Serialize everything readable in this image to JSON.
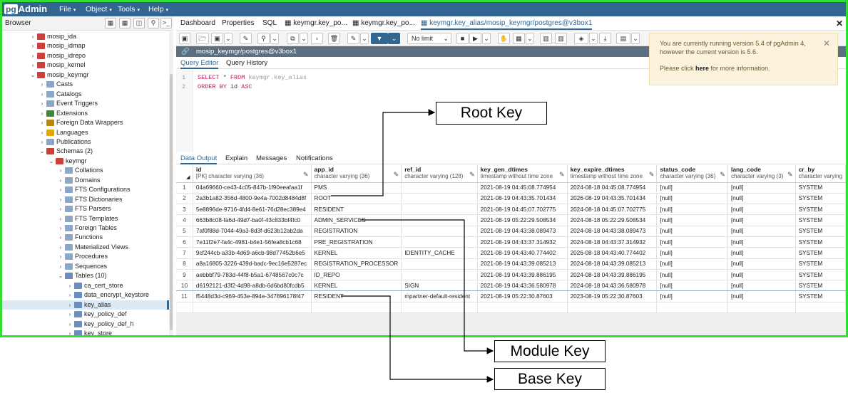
{
  "app": {
    "logo_pg": "pg",
    "logo_rest": "Admin"
  },
  "menu": [
    "File",
    "Object",
    "Tools",
    "Help"
  ],
  "browser": {
    "title": "Browser"
  },
  "tree": [
    {
      "label": "mosip_ida",
      "depth": 0,
      "expanded": false,
      "icon": "database-icon"
    },
    {
      "label": "mosip_idmap",
      "depth": 0,
      "expanded": false,
      "icon": "database-icon"
    },
    {
      "label": "mosip_idrepo",
      "depth": 0,
      "expanded": false,
      "icon": "database-icon"
    },
    {
      "label": "mosip_kernel",
      "depth": 0,
      "expanded": false,
      "icon": "database-icon"
    },
    {
      "label": "mosip_keymgr",
      "depth": 0,
      "expanded": true,
      "icon": "database-icon"
    },
    {
      "label": "Casts",
      "depth": 1,
      "expanded": false,
      "icon": "casts-icon"
    },
    {
      "label": "Catalogs",
      "depth": 1,
      "expanded": false,
      "icon": "catalogs-icon"
    },
    {
      "label": "Event Triggers",
      "depth": 1,
      "expanded": false,
      "icon": "event-trigger-icon"
    },
    {
      "label": "Extensions",
      "depth": 1,
      "expanded": false,
      "icon": "extension-icon"
    },
    {
      "label": "Foreign Data Wrappers",
      "depth": 1,
      "expanded": false,
      "icon": "fdw-icon"
    },
    {
      "label": "Languages",
      "depth": 1,
      "expanded": false,
      "icon": "language-icon"
    },
    {
      "label": "Publications",
      "depth": 1,
      "expanded": false,
      "icon": "publication-icon"
    },
    {
      "label": "Schemas (2)",
      "depth": 1,
      "expanded": true,
      "icon": "schemas-icon"
    },
    {
      "label": "keymgr",
      "depth": 2,
      "expanded": true,
      "icon": "schema-icon"
    },
    {
      "label": "Collations",
      "depth": 3,
      "expanded": false,
      "icon": "collation-icon"
    },
    {
      "label": "Domains",
      "depth": 3,
      "expanded": false,
      "icon": "domain-icon"
    },
    {
      "label": "FTS Configurations",
      "depth": 3,
      "expanded": false,
      "icon": "fts-config-icon"
    },
    {
      "label": "FTS Dictionaries",
      "depth": 3,
      "expanded": false,
      "icon": "fts-dictionary-icon"
    },
    {
      "label": "FTS Parsers",
      "depth": 3,
      "expanded": false,
      "icon": "fts-parser-icon"
    },
    {
      "label": "FTS Templates",
      "depth": 3,
      "expanded": false,
      "icon": "fts-template-icon"
    },
    {
      "label": "Foreign Tables",
      "depth": 3,
      "expanded": false,
      "icon": "foreign-table-icon"
    },
    {
      "label": "Functions",
      "depth": 3,
      "expanded": false,
      "icon": "function-icon"
    },
    {
      "label": "Materialized Views",
      "depth": 3,
      "expanded": false,
      "icon": "mview-icon"
    },
    {
      "label": "Procedures",
      "depth": 3,
      "expanded": false,
      "icon": "procedure-icon"
    },
    {
      "label": "Sequences",
      "depth": 3,
      "expanded": false,
      "icon": "sequence-icon"
    },
    {
      "label": "Tables (10)",
      "depth": 3,
      "expanded": true,
      "icon": "tables-icon"
    },
    {
      "label": "ca_cert_store",
      "depth": 4,
      "expanded": false,
      "icon": "table-icon"
    },
    {
      "label": "data_encrypt_keystore",
      "depth": 4,
      "expanded": false,
      "icon": "table-icon"
    },
    {
      "label": "key_alias",
      "depth": 4,
      "expanded": false,
      "icon": "table-icon",
      "selected": true
    },
    {
      "label": "key_policy_def",
      "depth": 4,
      "expanded": false,
      "icon": "table-icon"
    },
    {
      "label": "key_policy_def_h",
      "depth": 4,
      "expanded": false,
      "icon": "table-icon"
    },
    {
      "label": "key_store",
      "depth": 4,
      "expanded": false,
      "icon": "table-icon"
    }
  ],
  "tabs": [
    "Dashboard",
    "Properties",
    "SQL",
    "keymgr.key_po...",
    "keymgr.key_po...",
    "keymgr.key_alias/mosip_keymgr/postgres@v3box1"
  ],
  "toolbar": {
    "limit": "No limit"
  },
  "connection": "mosip_keymgr/postgres@v3box1",
  "query_tabs": [
    "Query Editor",
    "Query History"
  ],
  "editor": {
    "line1_num": "1",
    "line2_num": "2",
    "l1_kw1": "SELECT",
    "l1_star": " * ",
    "l1_kw2": "FROM",
    "l1_schema": " keymgr.",
    "l1_tbl": "key_alias",
    "l2_kw1": "ORDER BY",
    "l2_col": " id ",
    "l2_kw2": "ASC"
  },
  "notice": {
    "line1": "You are currently running version 5.4 of pgAdmin 4,",
    "line2": "however the current version is 5.6.",
    "line3a": "Please click ",
    "line3b": "here",
    "line3c": " for more information."
  },
  "output_tabs": [
    "Data Output",
    "Explain",
    "Messages",
    "Notifications"
  ],
  "grid": {
    "columns": [
      {
        "name": "id",
        "type": "[PK] character varying (36)"
      },
      {
        "name": "app_id",
        "type": "character varying (36)"
      },
      {
        "name": "ref_id",
        "type": "character varying (128)"
      },
      {
        "name": "key_gen_dtimes",
        "type": "timestamp without time zone"
      },
      {
        "name": "key_expire_dtimes",
        "type": "timestamp without time zone"
      },
      {
        "name": "status_code",
        "type": "character varying (36)"
      },
      {
        "name": "lang_code",
        "type": "character varying (3)"
      },
      {
        "name": "cr_by",
        "type": "character varying"
      }
    ],
    "rows": [
      [
        "1",
        "04a69660-ce43-4c05-847b-1f90eeafaa1f",
        "PMS",
        "",
        "2021-08-19 04:45:08.774954",
        "2024-08-18 04:45:08.774954",
        "[null]",
        "[null]",
        "SYSTEM"
      ],
      [
        "2",
        "2a3b1a82-356d-4800-9e4a-7002d8484d8f",
        "ROOT",
        "",
        "2021-08-19 04:43:35.701434",
        "2026-08-19 04:43:35.701434",
        "[null]",
        "[null]",
        "SYSTEM"
      ],
      [
        "3",
        "5e8896de-9716-4fd4-8e61-76d28ec389e4",
        "RESIDENT",
        "",
        "2021-08-19 04:45:07.702775",
        "2024-08-18 04:45:07.702775",
        "[null]",
        "[null]",
        "SYSTEM"
      ],
      [
        "4",
        "663b8c08-fa6d-49d7-ba0f-43c833bf4fc0",
        "ADMIN_SERVICES",
        "",
        "2021-08-19 05:22:29.508534",
        "2024-08-18 05:22:29.508534",
        "[null]",
        "[null]",
        "SYSTEM"
      ],
      [
        "5",
        "7af0f88d-7044-49a3-8d3f-d623b12ab2da",
        "REGISTRATION",
        "",
        "2021-08-19 04:43:38.089473",
        "2024-08-18 04:43:38.089473",
        "[null]",
        "[null]",
        "SYSTEM"
      ],
      [
        "6",
        "7e11f2e7-fa4c-4981-b4e1-56fea8cb1c68",
        "PRE_REGISTRATION",
        "",
        "2021-08-19 04:43:37.314932",
        "2024-08-18 04:43:37.314932",
        "[null]",
        "[null]",
        "SYSTEM"
      ],
      [
        "7",
        "9cf244cb-a33b-4d69-a6cb-98d77452b6e5",
        "KERNEL",
        "IDENTITY_CACHE",
        "2021-08-19 04:43:40.774402",
        "2026-08-18 04:43:40.774402",
        "[null]",
        "[null]",
        "SYSTEM"
      ],
      [
        "8",
        "a8a16805-3226-439d-badc-9ec16e5287ec",
        "REGISTRATION_PROCESSOR",
        "",
        "2021-08-19 04:43:39.085213",
        "2024-08-18 04:43:39.085213",
        "[null]",
        "[null]",
        "SYSTEM"
      ],
      [
        "9",
        "aebbbf79-783d-44f8-b5a1-6748567c0c7c",
        "ID_REPO",
        "",
        "2021-08-19 04:43:39.886195",
        "2024-08-18 04:43:39.886195",
        "[null]",
        "[null]",
        "SYSTEM"
      ],
      [
        "10",
        "d6192121-d3f2-4d98-a8db-6d6bd80fcdb5",
        "KERNEL",
        "SIGN",
        "2021-08-19 04:43:36.580978",
        "2024-08-18 04:43:36.580978",
        "[null]",
        "[null]",
        "SYSTEM"
      ],
      [
        "11",
        "f5448d3d-c969-453e-894e-347896178f47",
        "RESIDENT",
        "mpartner-default-resident",
        "2021-08-19 05:22:30.87603",
        "2023-08-19 05:22:30.87603",
        "[null]",
        "[null]",
        "SYSTEM"
      ]
    ]
  },
  "callouts": {
    "root": "Root Key",
    "module": "Module Key",
    "base": "Base Key"
  },
  "colors": {
    "brand": "#326690",
    "frame": "#33dd33",
    "notice_bg": "#fcf3dc"
  }
}
